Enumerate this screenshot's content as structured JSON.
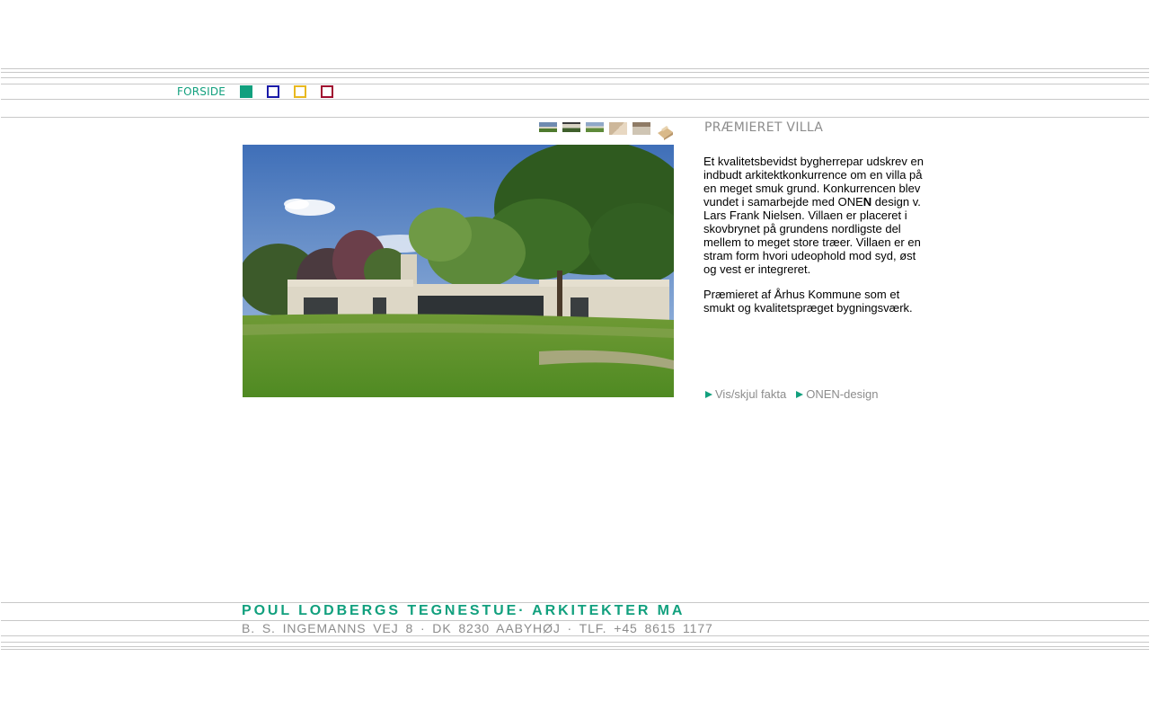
{
  "nav": {
    "home_label": "FORSIDE",
    "squares": [
      {
        "color": "#12a07e",
        "filled": true
      },
      {
        "color": "#1a1aa8",
        "filled": false
      },
      {
        "color": "#e8b820",
        "filled": false
      },
      {
        "color": "#a01030",
        "filled": false
      }
    ]
  },
  "gallery": {
    "thumbnails": [
      "thumbnail-1",
      "thumbnail-2",
      "thumbnail-3",
      "thumbnail-4",
      "thumbnail-5",
      "thumbnail-6"
    ]
  },
  "project": {
    "title": "PRÆMIERET VILLA",
    "paragraph1_a": "Et kvalitetsbevidst bygherrepar udskrev en indbudt arkitektkonkurrence om en villa på en meget smuk grund. Konkurrencen blev vundet i samarbejde med ONE",
    "paragraph1_b": "N",
    "paragraph1_c": " design v. Lars Frank Nielsen.  Villaen er placeret i skovbrynet på grundens nordligste del mellem to meget store træer. Villaen er en stram form hvori udeophold mod syd, øst og vest er integreret.",
    "paragraph2": "Præmieret af Århus Kommune som et smukt og kvalitetspræget bygningsværk."
  },
  "links": {
    "facts": "Vis/skjul fakta",
    "onen": "ONEN-design"
  },
  "footer": {
    "name": "POUL LODBERGS TEGNESTUE· ARKITEKTER MA",
    "address": "B. S. INGEMANNS VEJ 8 · DK 8230 AABYHØJ · TLF. +45 8615 1177"
  },
  "colors": {
    "accent": "#12a07e",
    "muted": "#8c8c8c",
    "rule": "#c8c8c8"
  }
}
